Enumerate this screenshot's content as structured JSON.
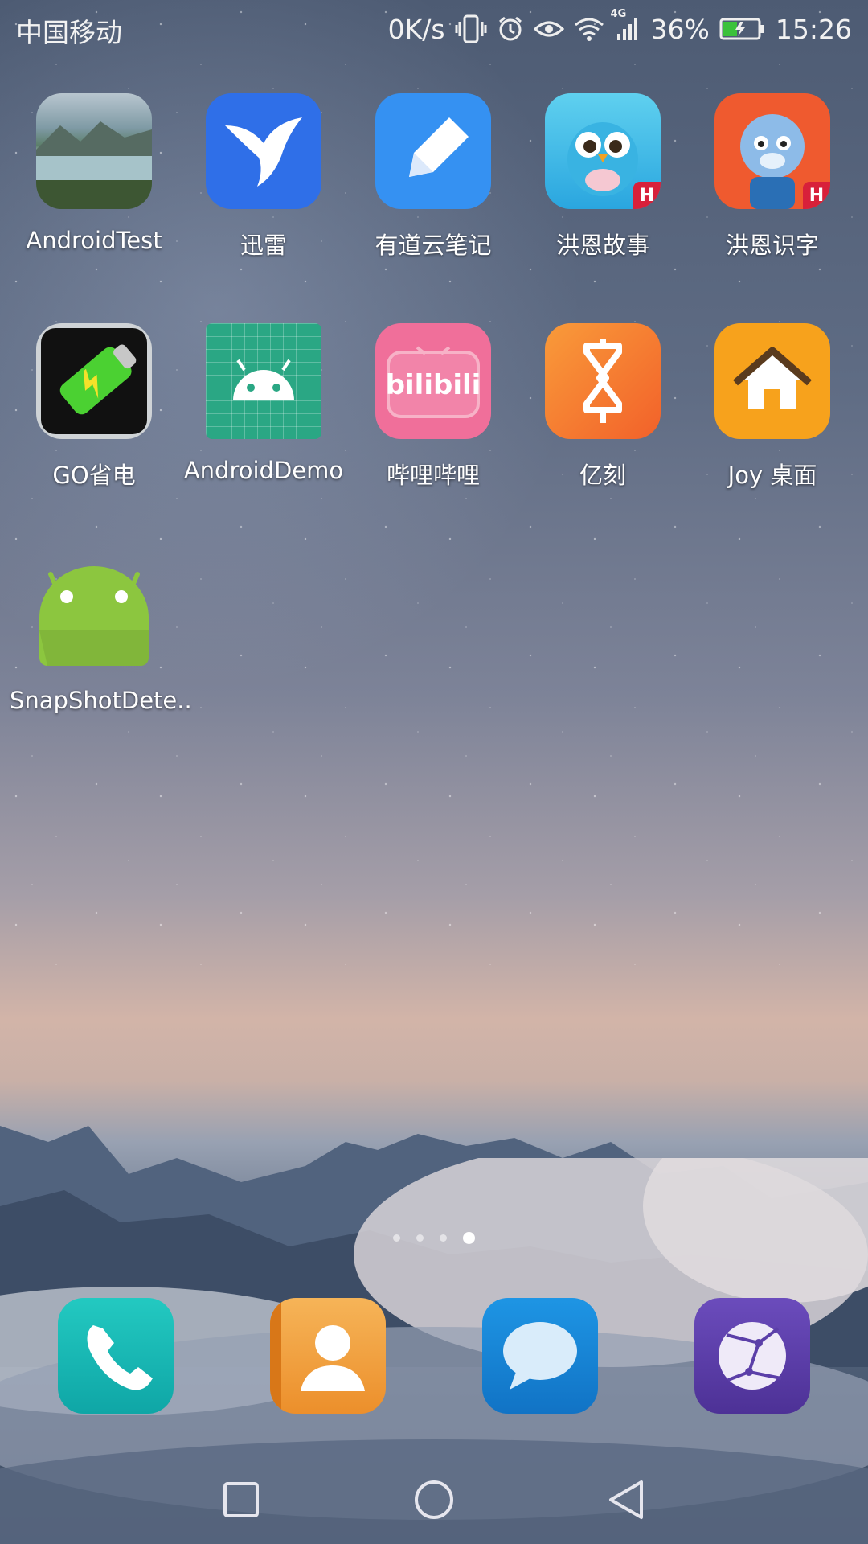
{
  "status_bar": {
    "carrier": "中国移动",
    "net_speed": "0K/s",
    "network_type": "4G",
    "battery_percent": "36%",
    "time": "15:26",
    "icons": [
      "vibrate-icon",
      "alarm-icon",
      "eye-comfort-icon",
      "wifi-icon",
      "signal-icon",
      "battery-icon"
    ]
  },
  "apps": [
    {
      "label": "AndroidTest",
      "icon": "landscape-photo-icon"
    },
    {
      "label": "迅雷",
      "icon": "thunder-bird-icon",
      "color": "#2f6fe8"
    },
    {
      "label": "有道云笔记",
      "icon": "pencil-note-icon",
      "color": "#3591f2"
    },
    {
      "label": "洪恩故事",
      "icon": "owl-icon",
      "badge": "H"
    },
    {
      "label": "洪恩识字",
      "icon": "tiger-icon",
      "badge": "H"
    },
    {
      "label": "GO省电",
      "icon": "battery-charge-icon"
    },
    {
      "label": "AndroidDemo",
      "icon": "android-grid-icon",
      "color": "#2aa784"
    },
    {
      "label": "哔哩哔哩",
      "icon": "bilibili-tv-icon",
      "color": "#f06f9a"
    },
    {
      "label": "亿刻",
      "icon": "yike-icon",
      "color": "#f47a2b"
    },
    {
      "label": "Joy 桌面",
      "icon": "house-icon",
      "color": "#f7a21c"
    },
    {
      "label": "SnapShotDete..",
      "icon": "android-robot-icon",
      "color": "#8cc63f"
    }
  ],
  "page_indicator": {
    "pages": 4,
    "current": 4
  },
  "dock": [
    {
      "name": "phone",
      "icon": "phone-icon",
      "color": "#18b7b3"
    },
    {
      "name": "contacts",
      "icon": "contacts-icon",
      "color": "#f2a046"
    },
    {
      "name": "messages",
      "icon": "message-icon",
      "color": "#1a84d6"
    },
    {
      "name": "browser",
      "icon": "browser-globe-icon",
      "color": "#5b3fa8"
    }
  ],
  "nav_bar": {
    "buttons": [
      "recents-square-icon",
      "home-circle-icon",
      "back-triangle-icon"
    ]
  }
}
